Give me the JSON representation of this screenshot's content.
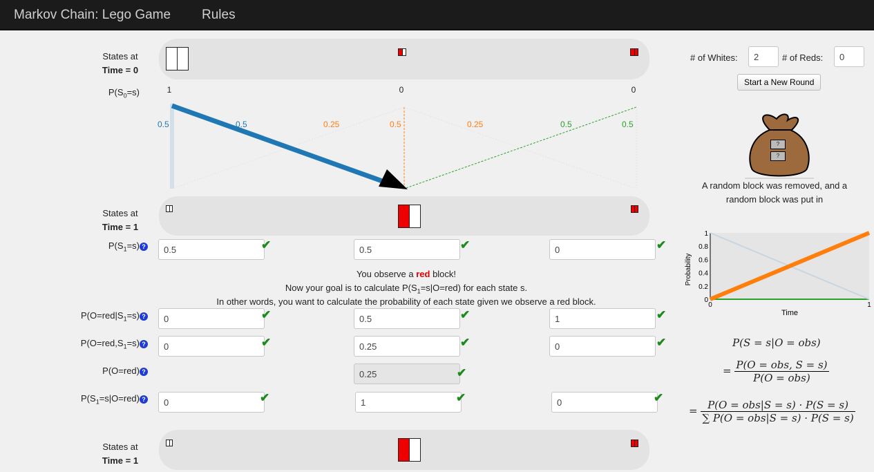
{
  "nav": {
    "brand": "Markov Chain: Lego Game",
    "rules": "Rules"
  },
  "row0": {
    "states_at": "States at",
    "time": "Time = 0",
    "prob_label": "P(S",
    "prob_sub": "0",
    "prob_tail": "=s)",
    "probs": [
      "1",
      "0",
      "0"
    ]
  },
  "transitions": {
    "labels": [
      "0.5",
      "0.5",
      "0.25",
      "0.5",
      "0.25",
      "0.5",
      "0.5"
    ]
  },
  "row1": {
    "states_at": "States at",
    "time": "Time = 1",
    "prob_label": "P(S",
    "prob_sub": "1",
    "prob_tail": "=s)",
    "values": [
      "0.5",
      "0.5",
      "0"
    ]
  },
  "observation": {
    "line1_pre": "You observe a ",
    "line1_color": "red",
    "line1_post": " block!",
    "line2_pre": "Now your goal is to calculate P(S",
    "line2_sub": "1",
    "line2_post": "=s|O=red) for each state s.",
    "line3": "In other words, you want to calculate the probability of each state given we observe a red block."
  },
  "likelihood": {
    "label_pre": "P(O=red|S",
    "label_sub": "1",
    "label_post": "=s)",
    "values": [
      "0",
      "0.5",
      "1"
    ]
  },
  "joint": {
    "label_pre": "P(O=red,S",
    "label_sub": "1",
    "label_post": "=s)",
    "values": [
      "0",
      "0.25",
      "0"
    ]
  },
  "evidence": {
    "label": "P(O=red)",
    "value": "0.25"
  },
  "posterior": {
    "label_pre": "P(S",
    "label_sub": "1",
    "label_post": "=s|O=red)",
    "values": [
      "0",
      "1",
      "0"
    ]
  },
  "row2": {
    "states_at": "States at",
    "time": "Time = 1"
  },
  "help_glyph": "?",
  "check_glyph": "✔",
  "controls": {
    "whites_label": "# of Whites:",
    "whites_value": "2",
    "reds_label": "# of Reds:",
    "reds_value": "0",
    "start_button": "Start a New Round"
  },
  "bag": {
    "slot1": "?",
    "slot2": "?",
    "caption": "A random block was removed, and a random block was put in"
  },
  "prob_chart": {
    "ylabel": "Probability",
    "xlabel": "Time",
    "yticks": [
      "0",
      "0.2",
      "0.4",
      "0.6",
      "0.8",
      "1"
    ],
    "xticks": [
      "0",
      "1"
    ]
  },
  "chart_data": {
    "type": "line",
    "x": [
      0,
      1
    ],
    "ylim": [
      0,
      1
    ],
    "xlabel": "Time",
    "ylabel": "Probability",
    "series": [
      {
        "values": [
          0,
          1
        ],
        "color": "#ff7f0e"
      },
      {
        "values": [
          1,
          0
        ],
        "color": "#c8d6e2"
      },
      {
        "values": [
          0,
          0
        ],
        "color": "#2ca02c"
      }
    ]
  },
  "formulas": {
    "f1": "P(S = s|O = obs)",
    "f2_num": "P(O = obs, S = s)",
    "f2_den": "P(O = obs)",
    "f3_num": "P(O = obs|S = s) · P(S = s)",
    "f3_den": "∑ P(O = obs|S = s) · P(S = s)",
    "eq": "="
  },
  "colors": {
    "blue": "#1f77b4",
    "orange": "#ff7f0e",
    "green": "#2ca02c",
    "red": "#e00000"
  }
}
